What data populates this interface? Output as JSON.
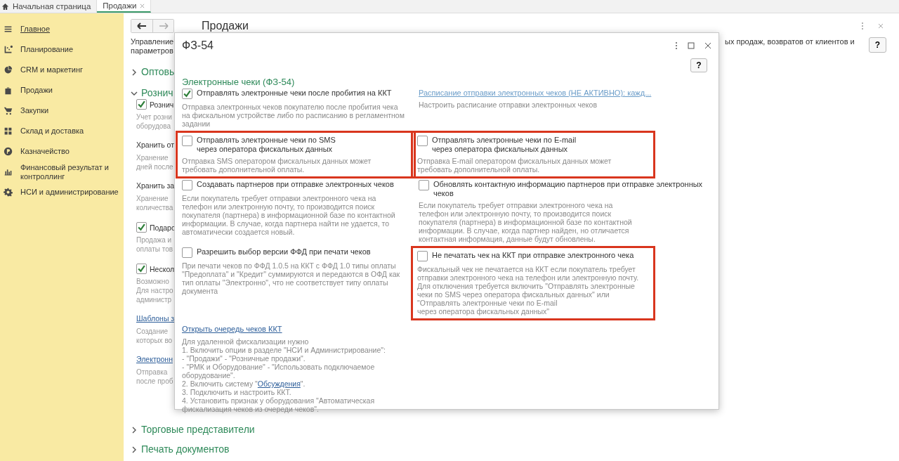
{
  "tabs": [
    {
      "label": "Начальная страница",
      "selected": false,
      "closable": false
    },
    {
      "label": "Продажи",
      "selected": true,
      "closable": true
    }
  ],
  "sidebar": {
    "items": [
      {
        "label": "Главное",
        "selected": true
      },
      {
        "label": "Планирование",
        "selected": false
      },
      {
        "label": "CRM и маркетинг",
        "selected": false
      },
      {
        "label": "Продажи",
        "selected": false
      },
      {
        "label": "Закупки",
        "selected": false
      },
      {
        "label": "Склад и доставка",
        "selected": false
      },
      {
        "label": "Казначейство",
        "selected": false
      },
      {
        "label": "Финансовый результат и контроллинг",
        "selected": false
      },
      {
        "label": "НСИ и администрирование",
        "selected": false
      }
    ]
  },
  "page": {
    "title": "Продажи",
    "description_left": [
      "Управление",
      "параметров"
    ],
    "description_right": "ых продаж, возвратов от клиентов и",
    "help": "?",
    "items": [
      {
        "kind": "heading",
        "text": "Оптовы",
        "expanded": false
      },
      {
        "kind": "heading",
        "text": "Рознич",
        "expanded": true
      },
      {
        "kind": "checkbox",
        "text": "Рознич",
        "checked": true
      },
      {
        "kind": "hint",
        "text": "Учет розни\nоборудова"
      },
      {
        "kind": "label",
        "text": "Хранить от"
      },
      {
        "kind": "hint",
        "text": "Хранение\nдней после"
      },
      {
        "kind": "label",
        "text": "Хранить за"
      },
      {
        "kind": "hint",
        "text": "Хранение\nколичества"
      },
      {
        "kind": "checkbox",
        "text": "Подаро",
        "checked": true
      },
      {
        "kind": "hint",
        "text": "Продажа и\nоплаты тов"
      },
      {
        "kind": "checkbox",
        "text": "Нескол",
        "checked": true
      },
      {
        "kind": "hint",
        "text": "Возможно\nДля настро\nадминистр"
      },
      {
        "kind": "link",
        "text": "Шаблоны з"
      },
      {
        "kind": "hint",
        "text": "Создание\nкоторых во"
      },
      {
        "kind": "link",
        "text": "Электронн"
      },
      {
        "kind": "hint",
        "text": "Отправка\nпосле проб"
      }
    ],
    "bottom_headings": [
      {
        "text": "Торговые представители",
        "expanded": false
      },
      {
        "text": "Печать документов",
        "expanded": false
      }
    ]
  },
  "dialog": {
    "title": "ФЗ-54",
    "help": "?",
    "section": "Электронные чеки (ФЗ-54)",
    "rows": [
      {
        "left": {
          "kind": "checkbox",
          "label": "Отправлять электронные чеки после пробития на ККТ",
          "checked": true,
          "description": "Отправка электронных чеков покупателю после пробития чека на фискальном устройстве либо по расписанию в регламентном задании",
          "highlighted": false
        },
        "right": {
          "kind": "link",
          "label": "Расписание отправки электронных чеков (НЕ АКТИВНО): кажд...",
          "description": "Настроить расписание отправки электронных чеков",
          "highlighted": false
        }
      },
      {
        "left": {
          "kind": "checkbox",
          "label": "Отправлять электронные чеки по SMS\nчерез оператора фискальных данных",
          "checked": false,
          "description": "Отправка SMS оператором фискальных данных может требовать дополнительной оплаты.",
          "highlighted": true
        },
        "right": {
          "kind": "checkbox",
          "label": "Отправлять электронные чеки по E-mail\nчерез оператора фискальных данных",
          "checked": false,
          "description": "Отправка E-mail оператором фискальных данных может требовать дополнительной оплаты.",
          "highlighted": true
        }
      },
      {
        "left": {
          "kind": "checkbox",
          "label": "Создавать партнеров при отправке электронных чеков",
          "checked": false,
          "description": "Если покупатель требует отправки электронного чека на телефон или электронную почту, то производится поиск покупателя (партнера) в информационной базе по контактной информации. В случае, когда партнера найти не удается, то автоматически создается новый.",
          "highlighted": false
        },
        "right": {
          "kind": "checkbox",
          "label": "Обновлять контактную информацию партнеров при отправке электронных чеков",
          "checked": false,
          "description": "Если покупатель требует отправки электронного чека на телефон или электронную почту, то производится поиск покупателя (партнера) в информационной базе по контактной информации. В случае, когда партнер найден, но отличается контактная информация, данные будут обновлены.",
          "highlighted": false
        }
      },
      {
        "left": {
          "kind": "checkbox",
          "label": "Разрешить выбор версии ФФД при печати чеков",
          "checked": false,
          "description": "При печати чеков по ФФД 1.0.5 на ККТ с ФФД 1.0 типы оплаты \"Предоплата\" и \"Кредит\" суммируются и передаются в ОФД как тип оплаты \"Электронно\", что не соответствует типу оплаты документа",
          "highlighted": false
        },
        "right": {
          "kind": "checkbox",
          "label": "Не печатать чек на ККТ при отправке электронного чека",
          "checked": false,
          "description": "Фискальный чек не печатается на ККТ если покупатель требует отправки электронного чека на телефон или электронную почту. Для отключения требуется включить \"Отправлять электронные чеки по SMS через оператора фискальных данных\" или \"Отправлять электронные чеки по E-mail\nчерез оператора фискальных данных\"",
          "highlighted": true
        }
      }
    ],
    "queue_link": "Открыть очередь чеков ККТ",
    "instructions": [
      {
        "text": "Для удаленной фискализации нужно"
      },
      {
        "text": "1. Включить опции в разделе \"НСИ и Администрирование\":"
      },
      {
        "text": " - \"Продажи\" - \"Розничные продажи\"."
      },
      {
        "text": " - \"РМК и Оборудование\" - \"Использовать подключаемое оборудование\"."
      },
      {
        "text": "2. Включить систему \"",
        "link": "Обсуждения",
        "after": "\"."
      },
      {
        "text": "3. Подключить и настроить ККТ."
      },
      {
        "text": "4. Установить признак у оборудования \"Автоматическая фискализация чеков из очереди чеков\"."
      }
    ]
  }
}
